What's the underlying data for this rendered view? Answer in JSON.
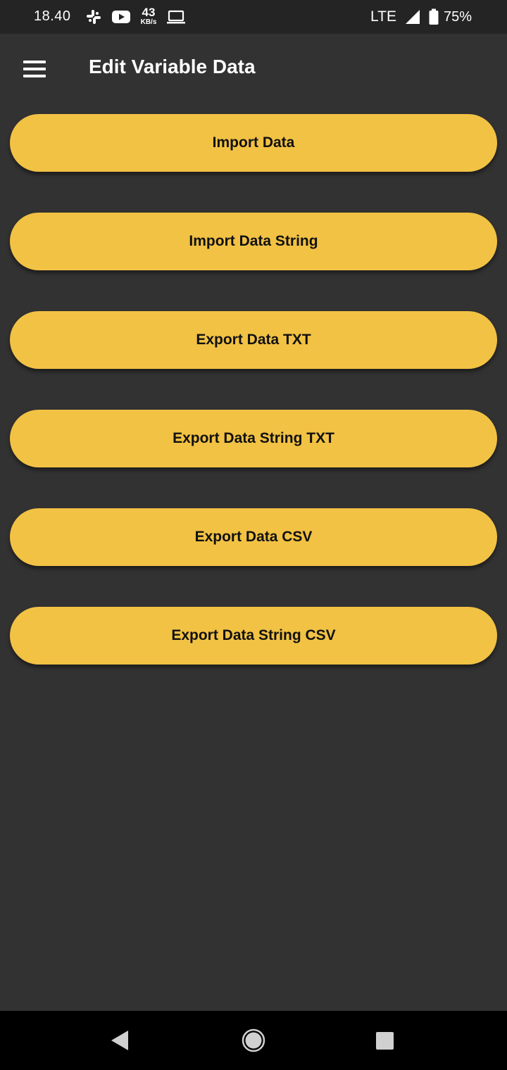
{
  "status_bar": {
    "time": "18.40",
    "net_speed_value": "43",
    "net_speed_unit": "KB/s",
    "network": "LTE",
    "battery": "75%",
    "icons": [
      "slack-icon",
      "youtube-icon",
      "laptop-icon",
      "signal-icon",
      "battery-icon"
    ]
  },
  "app_bar": {
    "title": "Edit Variable Data",
    "menu_icon": "hamburger-menu-icon"
  },
  "buttons": [
    {
      "label": "Import Data"
    },
    {
      "label": "Import Data String"
    },
    {
      "label": "Export Data TXT"
    },
    {
      "label": "Export Data String TXT"
    },
    {
      "label": "Export Data CSV"
    },
    {
      "label": "Export Data String CSV"
    }
  ],
  "nav_bar": {
    "icons": [
      "back-icon",
      "home-icon",
      "recents-icon"
    ]
  },
  "colors": {
    "background": "#323232",
    "status_bar": "#242424",
    "button": "#f2c244",
    "button_text": "#111111",
    "title_text": "#ffffff",
    "nav_bar": "#000000"
  }
}
